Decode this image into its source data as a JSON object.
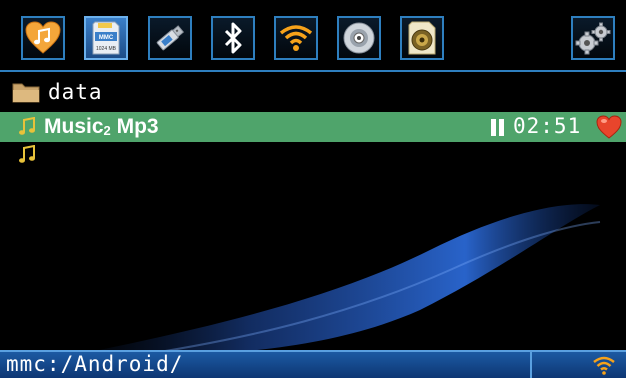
{
  "toolbar": {
    "buttons": [
      {
        "name": "favorites-music-button",
        "icon": "heart-music-icon"
      },
      {
        "name": "mmc-card-button",
        "icon": "sd-card-icon",
        "card_label": "MMC",
        "card_size": "1024 MB"
      },
      {
        "name": "usb-button",
        "icon": "usb-drive-icon"
      },
      {
        "name": "bluetooth-button",
        "icon": "bluetooth-icon"
      },
      {
        "name": "wifi-button",
        "icon": "wifi-icon"
      },
      {
        "name": "cd-button",
        "icon": "disc-icon"
      },
      {
        "name": "speaker-button",
        "icon": "speaker-icon"
      },
      {
        "name": "settings-button",
        "icon": "gears-icon"
      }
    ]
  },
  "list": {
    "folder_label": "data",
    "track": {
      "title_main": "Music",
      "title_sub": "2",
      "title_tail": " Mp3",
      "time": "02:51"
    }
  },
  "status": {
    "path": "mmc:/Android/"
  },
  "colors": {
    "accent": "#2e7fbf",
    "selected_row": "#4fa46b",
    "status_bar": "#1c5aa3"
  }
}
